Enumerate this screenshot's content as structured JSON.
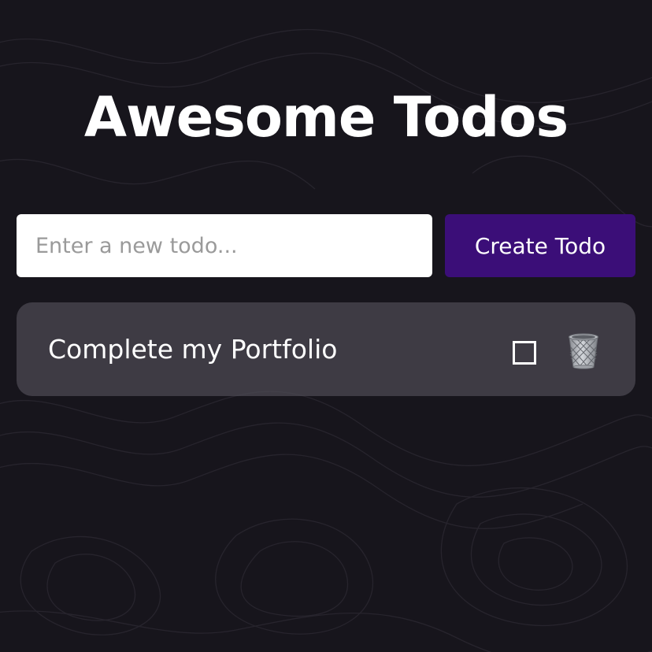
{
  "app": {
    "title": "Awesome Todos"
  },
  "form": {
    "input_value": "",
    "input_placeholder": "Enter a new todo...",
    "create_label": "Create Todo"
  },
  "todos": [
    {
      "text": "Complete my Portfolio",
      "completed": false
    }
  ],
  "icons": {
    "checkbox": "checkbox-icon",
    "delete": "wastebasket-icon"
  },
  "colors": {
    "background": "#17151c",
    "button": "#3b0e78",
    "todo_card": "#4e4b54",
    "text": "#ffffff"
  }
}
